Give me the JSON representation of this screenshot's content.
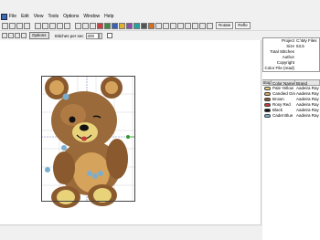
{
  "menu": [
    "File",
    "Edit",
    "View",
    "Tools",
    "Options",
    "Window",
    "Help"
  ],
  "toolbar": {
    "rotate_label": "Rotate",
    "reflect_label": "Refle"
  },
  "options_bar": {
    "options_label": "Options",
    "stitches_per_sec_label": "Stitches per sec",
    "stitches_per_sec_value": "200"
  },
  "properties": [
    {
      "key": "Project",
      "value": "C:\\My Files"
    },
    {
      "key": "Size",
      "value": "63,5"
    },
    {
      "key": "Total Stitches",
      "value": ""
    },
    {
      "key": "Author",
      "value": ""
    },
    {
      "key": "Copyright",
      "value": ""
    },
    {
      "key": "Color File (read)",
      "value": ""
    }
  ],
  "color_table": {
    "headers": [
      "Stop",
      "Color Name",
      "Brand"
    ],
    "rows": [
      {
        "stop": "1",
        "name": "Pale Yellow",
        "brand": "Aadeira Ray",
        "color": "#e8d27a"
      },
      {
        "stop": "2",
        "name": "Candied Ginger",
        "brand": "Aadeira Ray",
        "color": "#d6a35c"
      },
      {
        "stop": "3",
        "name": "Brown",
        "brand": "Aadeira Ray",
        "color": "#8a5a2e"
      },
      {
        "stop": "4",
        "name": "Rosy Red",
        "brand": "Aadeira Ray",
        "color": "#c23a3a"
      },
      {
        "stop": "5",
        "name": "Black",
        "brand": "Aadeira Ray",
        "color": "#111111"
      },
      {
        "stop": "6",
        "name": "Cadet Blue",
        "brand": "Aadeira Ray",
        "color": "#7aaed0"
      }
    ]
  }
}
